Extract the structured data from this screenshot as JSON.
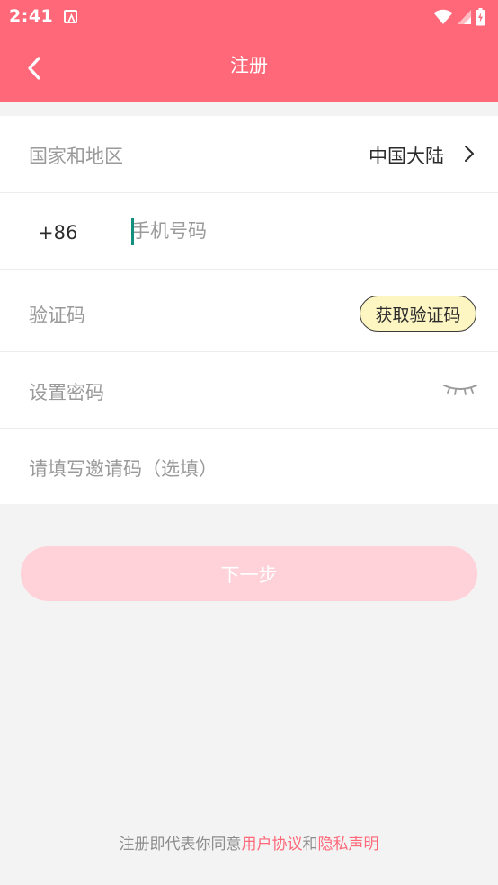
{
  "status_bar": {
    "time": "2:41"
  },
  "header": {
    "title": "注册"
  },
  "form": {
    "region": {
      "label": "国家和地区",
      "value": "中国大陆"
    },
    "phone": {
      "country_code": "+86",
      "placeholder": "手机号码",
      "value": ""
    },
    "code": {
      "label": "验证码",
      "button_label": "获取验证码"
    },
    "password": {
      "label": "设置密码"
    },
    "invite": {
      "label": "请填写邀请码（选填）"
    }
  },
  "next_button": {
    "label": "下一步"
  },
  "footer": {
    "prefix": "注册即代表你同意",
    "user_agreement": "用户协议",
    "connector": "和",
    "privacy_policy": "隐私声明"
  },
  "colors": {
    "primary": "#fe6879",
    "next_button_disabled": "#ffd1d8",
    "code_button_bg": "#fdf5c2",
    "caret": "#11907e"
  },
  "icons": [
    "a-app-icon",
    "wifi-icon",
    "signal-icon",
    "battery-icon",
    "back-arrow-icon",
    "chevron-right-icon",
    "closed-eye-icon"
  ]
}
